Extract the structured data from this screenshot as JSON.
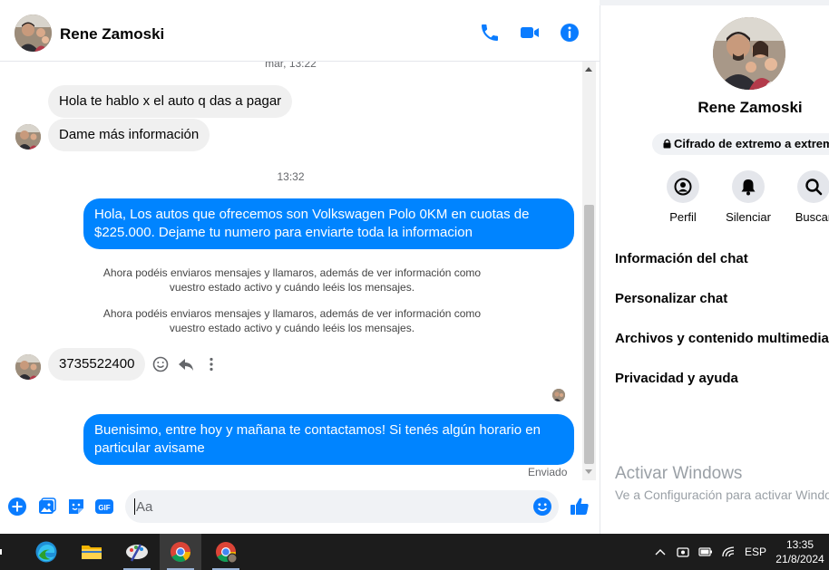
{
  "contact": {
    "name": "Rene Zamoski"
  },
  "thread": {
    "timestamps": [
      "mar, 13:22",
      "13:32"
    ],
    "messages": [
      {
        "direction": "in",
        "text": "Hola te hablo x el auto q das a pagar"
      },
      {
        "direction": "in",
        "text": "Dame más información"
      },
      {
        "direction": "out",
        "lines": [
          "Hola, Los autos que ofrecemos son Volkswagen Polo 0KM en cuotas de",
          "$225.000. Dejame tu numero para enviarte toda la informacion"
        ]
      },
      {
        "direction": "in",
        "text": "3735522400"
      },
      {
        "direction": "out",
        "lines": [
          "Buenisimo, entre hoy y mañana te contactamos! Si tenés algún horario en",
          "particular avisame"
        ]
      }
    ],
    "notices": [
      {
        "lines": [
          "Ahora podéis enviaros mensajes y llamaros, además de ver información como",
          "vuestro estado activo y cuándo leéis los mensajes."
        ]
      },
      {
        "lines": [
          "Ahora podéis enviaros mensajes y llamaros, además de ver información como",
          "vuestro estado activo y cuándo leéis los mensajes."
        ]
      }
    ],
    "sent_status": "Enviado"
  },
  "composer": {
    "placeholder": "Aa",
    "gif_label": "GIF"
  },
  "panel": {
    "name": "Rene Zamoski",
    "encryption_label": "Cifrado de extremo a extremo",
    "actions": [
      {
        "label": "Perfil",
        "icon": "profile-icon"
      },
      {
        "label": "Silenciar",
        "icon": "bell-icon"
      },
      {
        "label": "Buscar",
        "icon": "search-icon"
      }
    ],
    "menu": [
      "Información del chat",
      "Personalizar chat",
      "Archivos y contenido multimedia",
      "Privacidad y ayuda"
    ],
    "watermark_title": "Activar Windows",
    "watermark_sub": "Ve a Configuración para activar Windows."
  },
  "taskbar": {
    "language": "ESP",
    "time": "13:35",
    "date": "21/8/2024"
  },
  "colors": {
    "accent": "#0084ff",
    "incoming": "#f0f0f0",
    "taskbar": "#1c1c1c"
  }
}
